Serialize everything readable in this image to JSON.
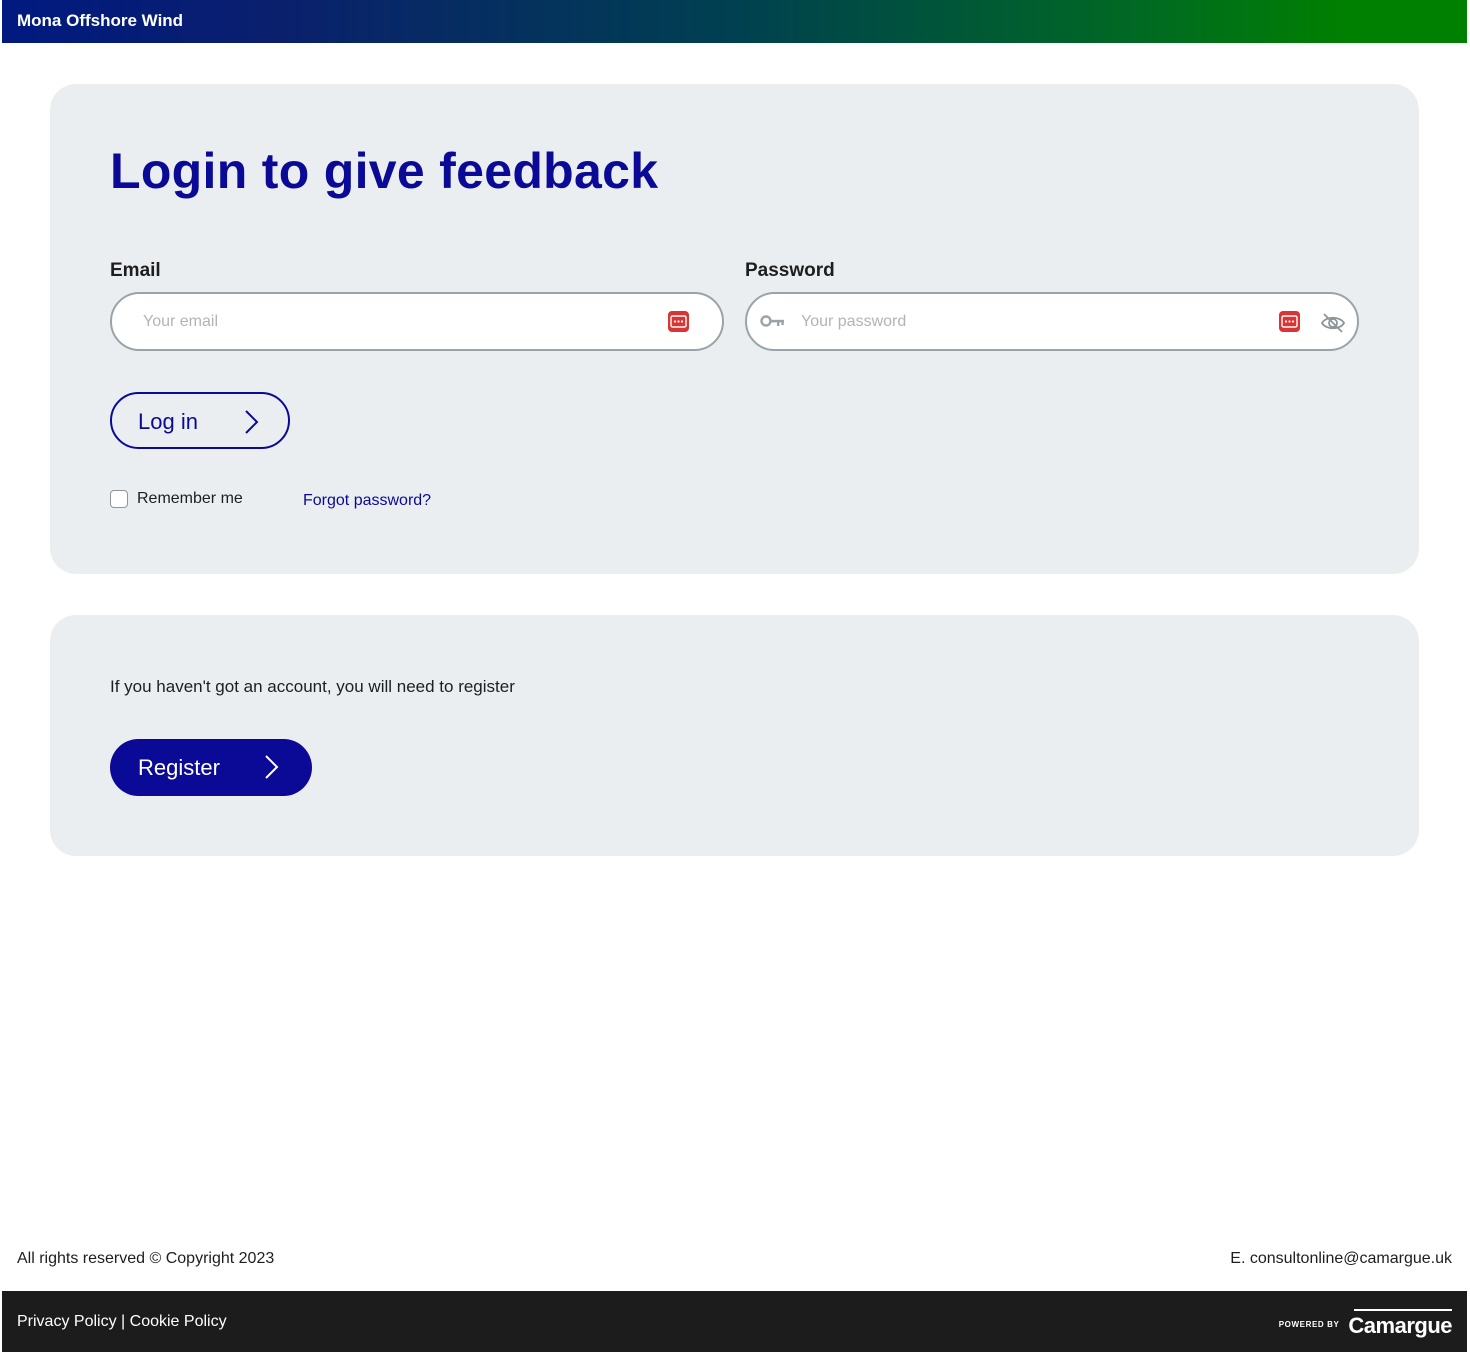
{
  "header": {
    "brand": "Mona Offshore Wind"
  },
  "login": {
    "title": "Login to give feedback",
    "email_label": "Email",
    "email_placeholder": "Your email",
    "password_label": "Password",
    "password_placeholder": "Your password",
    "login_button": "Log in",
    "remember_label": "Remember me",
    "remember_checked": false,
    "forgot_link": "Forgot password?"
  },
  "register": {
    "text": "If you haven't got an account, you will need to register",
    "button": "Register"
  },
  "footer": {
    "copyright": "All rights reserved © Copyright 2023",
    "contact": "E. consultonline@camargue.uk",
    "privacy": "Privacy Policy",
    "separator": "|",
    "cookie": "Cookie Policy",
    "powered_by": "POWERED BY",
    "logo_text": "Camargue"
  },
  "colors": {
    "primary": "#0a0a96",
    "card_bg": "#ebeef0",
    "footer_bg": "#1c1c1c",
    "password_manager": "#d93535",
    "gradient_start": "#001a80",
    "gradient_end": "#008000"
  },
  "icons": {
    "email_field": "password-manager-icon",
    "password_field_left": "key-icon",
    "password_field_right": [
      "password-manager-icon",
      "eye-slash-icon"
    ],
    "buttons": "chevron-right-icon"
  }
}
